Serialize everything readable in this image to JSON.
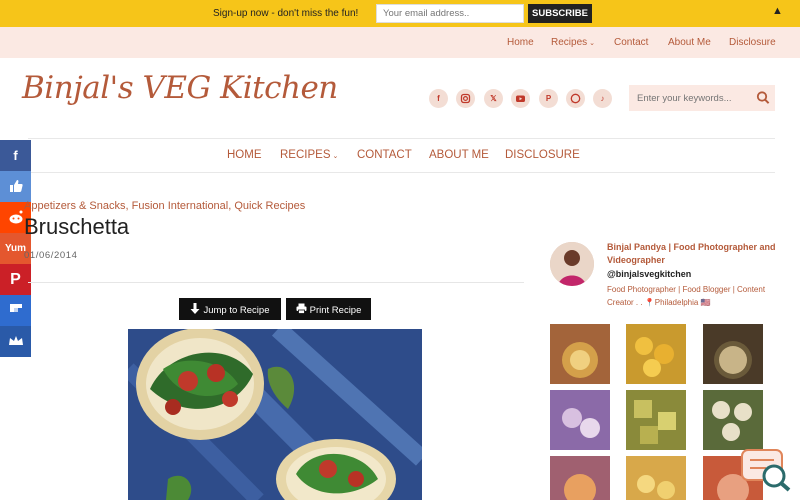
{
  "promo": {
    "text": "Sign-up now - don't miss the fun!",
    "email_placeholder": "Your email address..",
    "button": "SUBSCRIBE",
    "close_glyph": "▲"
  },
  "top_nav": {
    "home": "Home",
    "recipes": "Recipes",
    "contact": "Contact",
    "about": "About Me",
    "disclosure": "Disclosure"
  },
  "header": {
    "logo": "Binjal's VEG Kitchen",
    "social_icons": [
      "facebook-icon",
      "instagram-icon",
      "x-icon",
      "youtube-icon",
      "pinterest-icon",
      "whatsapp-icon",
      "tiktok-icon"
    ],
    "search_placeholder": "Enter your keywords..."
  },
  "main_nav": {
    "home": "HOME",
    "recipes": "RECIPES",
    "contact": "CONTACT",
    "about": "ABOUT ME",
    "disclosure": "DISCLOSURE"
  },
  "share_bar": [
    {
      "name": "facebook",
      "color": "#3b5998",
      "glyph": "f"
    },
    {
      "name": "like",
      "color": "#5d8fd6",
      "glyph": "👍"
    },
    {
      "name": "reddit",
      "color": "#ff4500",
      "glyph": "●"
    },
    {
      "name": "yummly",
      "color": "#e4572e",
      "glyph": "Yum"
    },
    {
      "name": "pinterest",
      "color": "#cb2027",
      "glyph": "P"
    },
    {
      "name": "flipboard",
      "color": "#2f6ccf",
      "glyph": "f"
    },
    {
      "name": "sumo",
      "color": "#2a5aa8",
      "glyph": "♛"
    }
  ],
  "article": {
    "cat1": "Appetizers & Snacks",
    "cat2": "Fusion International",
    "cat3": "Quick Recipes",
    "title": "Bruschetta",
    "date": "01/06/2014",
    "jump_button": "Jump to Recipe",
    "print_button": "Print Recipe"
  },
  "sidebar": {
    "name": "Binjal Pandya | Food Photographer and Videographer",
    "handle": "@binjalsvegkitchen",
    "bio": "Food Photographer | Food Blogger | Content Creator . . 📍Philadelphia 🇺🇸",
    "tiles": [
      "#a3643a",
      "#c99a2e",
      "#6b5a3c",
      "#8b6aa8",
      "#8a8a3a",
      "#5a6a3a",
      "#a06070",
      "#d8a84a",
      "#c85a3a"
    ]
  },
  "colors": {
    "accent": "#b45a3a",
    "promo_bg": "#f6c519",
    "nav_bg": "#fbe9e3"
  }
}
